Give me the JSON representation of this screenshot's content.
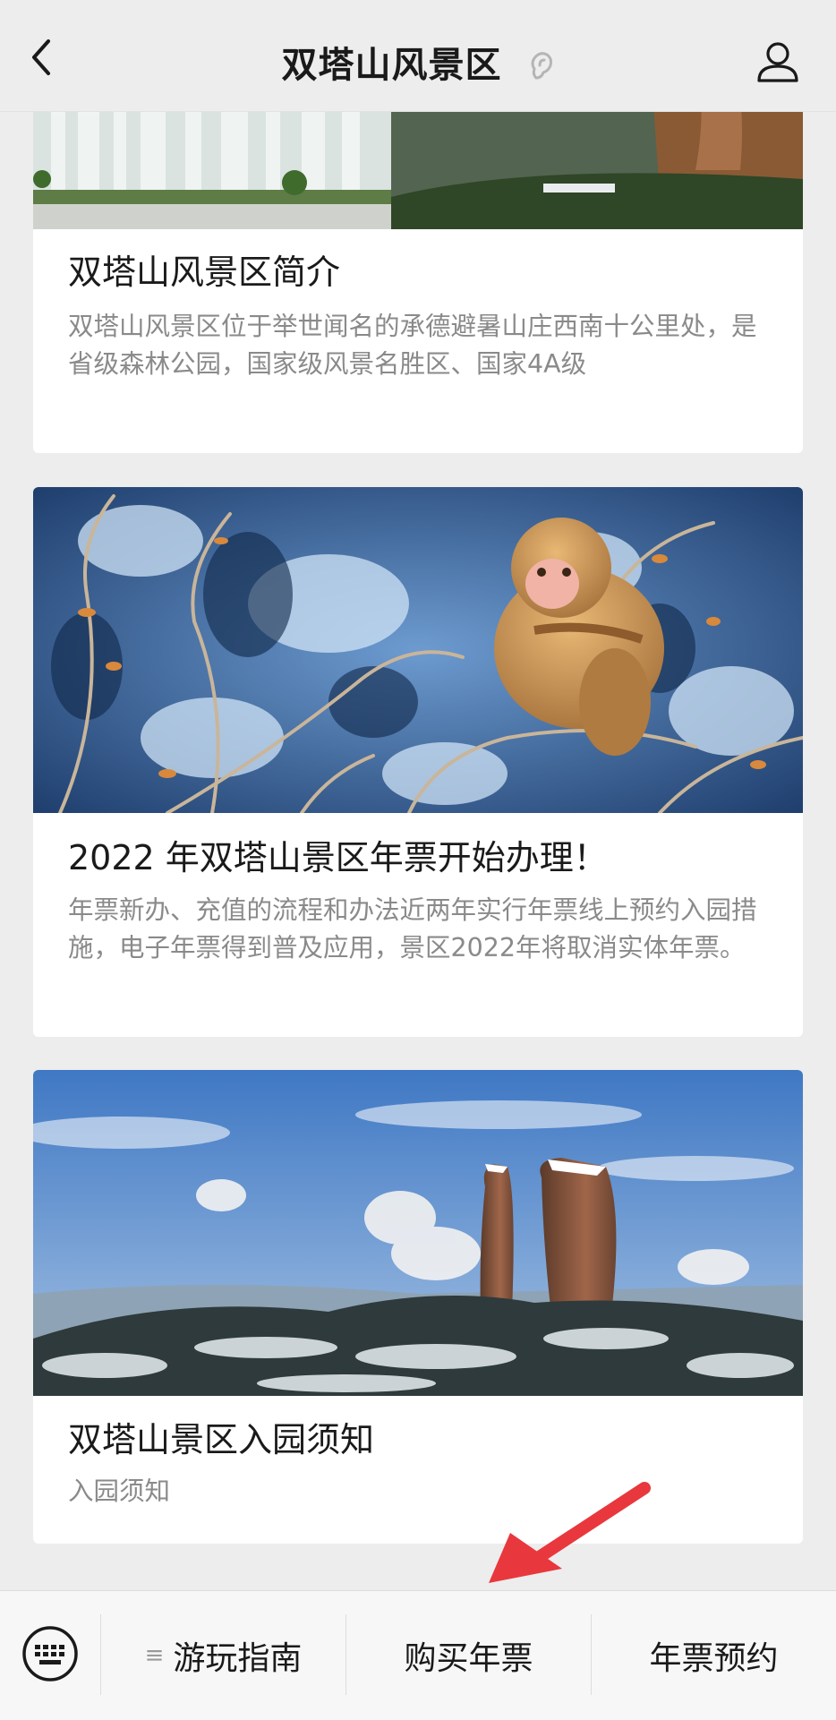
{
  "header": {
    "title": "双塔山风景区",
    "back_icon": "chevron-left-icon",
    "ear_icon": "ear-icon",
    "profile_icon": "person-icon"
  },
  "cards": [
    {
      "title": "双塔山风景区简介",
      "desc": "双塔山风景区位于举世闻名的承德避暑山庄西南十公里处，是省级森林公园，国家级风景名胜区、国家4A级"
    },
    {
      "title": "2022 年双塔山景区年票开始办理！",
      "desc": "年票新办、充值的流程和办法近两年实行年票线上预约入园措施，电子年票得到普及应用，景区2022年将取消实体年票。"
    },
    {
      "title": "双塔山景区入园须知",
      "desc": "入园须知"
    }
  ],
  "bottom_menu": {
    "keyboard_icon": "keyboard-icon",
    "items": [
      {
        "label": "游玩指南",
        "prefix": "≡"
      },
      {
        "label": "购买年票"
      },
      {
        "label": "年票预约"
      }
    ]
  },
  "colors": {
    "background": "#ededed",
    "annotation_arrow": "#e8383d"
  }
}
